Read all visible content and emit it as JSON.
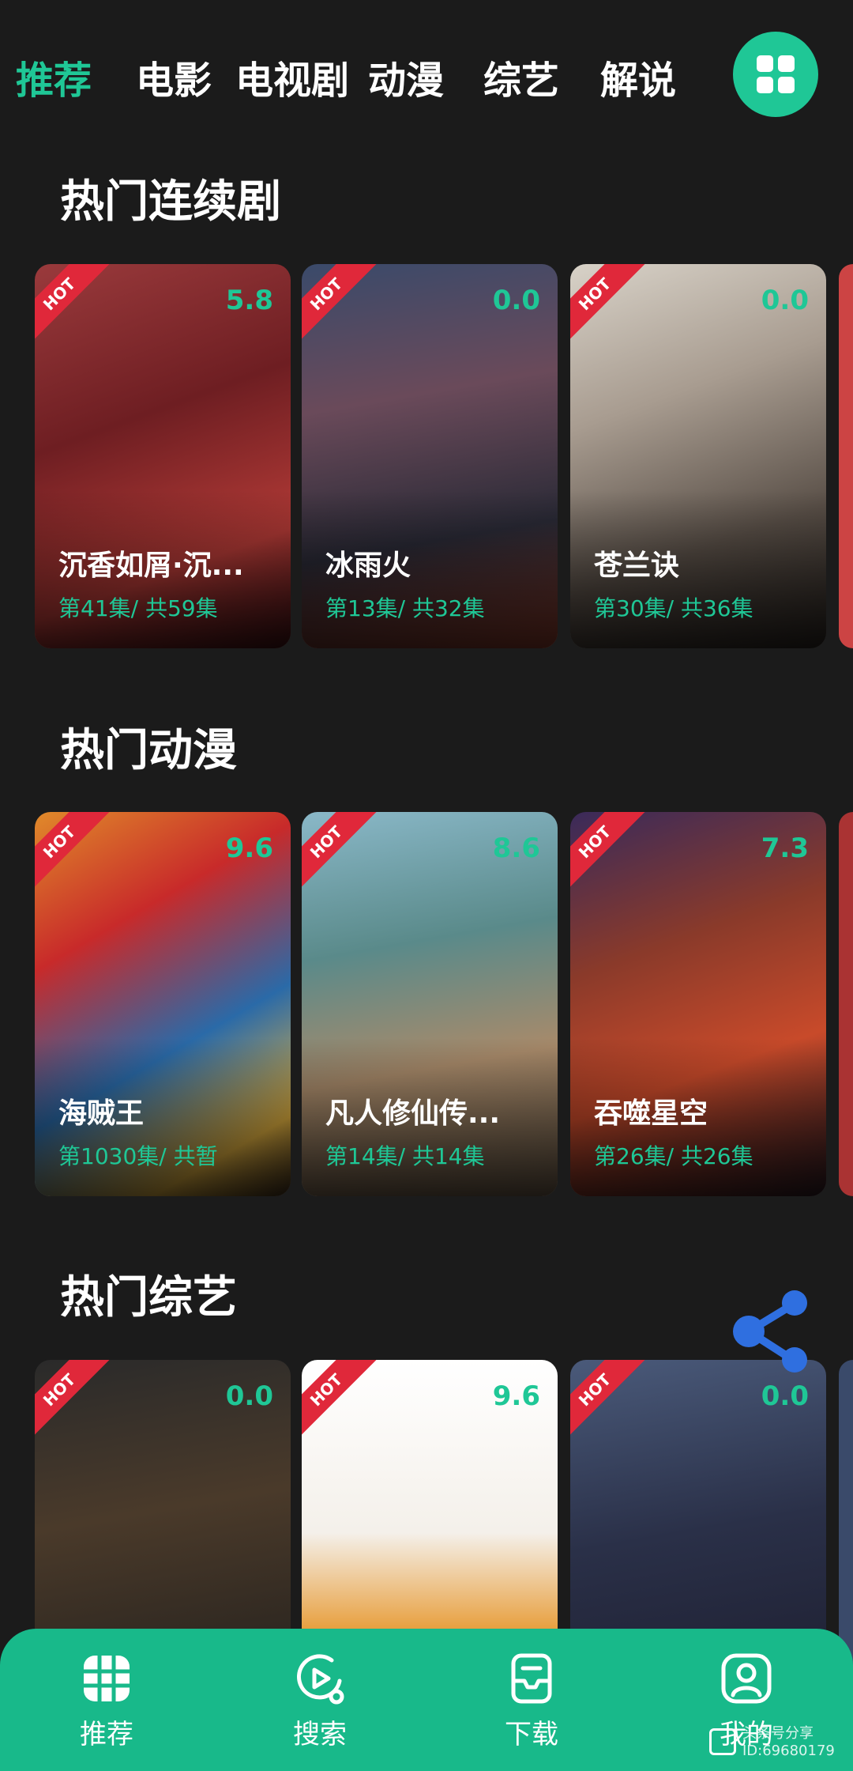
{
  "top_tabs": [
    "推荐",
    "电影",
    "电视剧",
    "动漫",
    "综艺",
    "解说"
  ],
  "menu_icon": "grid-icon",
  "sections": [
    {
      "title": "热门连续剧",
      "cards": [
        {
          "badge": "HOT",
          "score": "5.8",
          "name": "沉香如屑·沉...",
          "episodes": "第41集/ 共59集"
        },
        {
          "badge": "HOT",
          "score": "0.0",
          "name": "冰雨火",
          "episodes": "第13集/ 共32集"
        },
        {
          "badge": "HOT",
          "score": "0.0",
          "name": "苍兰诀",
          "episodes": "第30集/ 共36集"
        }
      ]
    },
    {
      "title": "热门动漫",
      "cards": [
        {
          "badge": "HOT",
          "score": "9.6",
          "name": "海贼王",
          "episodes": "第1030集/ 共暂"
        },
        {
          "badge": "HOT",
          "score": "8.6",
          "name": "凡人修仙传...",
          "episodes": "第14集/ 共14集"
        },
        {
          "badge": "HOT",
          "score": "7.3",
          "name": "吞噬星空",
          "episodes": "第26集/ 共26集"
        }
      ]
    },
    {
      "title": "热门综艺",
      "cards": [
        {
          "badge": "HOT",
          "score": "0.0",
          "name": "",
          "episodes": ""
        },
        {
          "badge": "HOT",
          "score": "9.6",
          "name": "",
          "episodes": ""
        },
        {
          "badge": "HOT",
          "score": "0.0",
          "name": "",
          "episodes": ""
        }
      ]
    }
  ],
  "share_icon": "share-icon",
  "bottom_nav": [
    {
      "label": "推荐",
      "icon": "grid-icon"
    },
    {
      "label": "搜索",
      "icon": "search-icon"
    },
    {
      "label": "下载",
      "icon": "download-icon"
    },
    {
      "label": "我的",
      "icon": "profile-icon"
    }
  ],
  "watermark": {
    "line1": "头条号分享",
    "line2": "ID:69680179"
  },
  "colors": {
    "accent": "#1fc796",
    "background": "#1b1b1b",
    "bottom_nav": "#18b98a",
    "hot_badge": "#e0283a",
    "share_fab": "#2f6fe0"
  }
}
